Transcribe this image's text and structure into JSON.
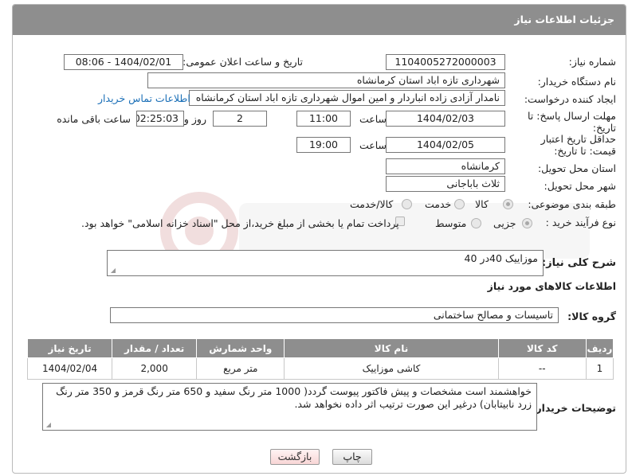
{
  "header": {
    "title": "جزئیات اطلاعات نیاز"
  },
  "need_number": {
    "label": "شماره نیاز:",
    "value": "1104005272000003"
  },
  "announce": {
    "label": "تاریخ و ساعت اعلان عمومی:",
    "value": "1404/02/01 - 08:06"
  },
  "buyer_org": {
    "label": "نام دستگاه خریدار:",
    "value": "شهرداری تازه اباد استان کرمانشاه"
  },
  "creator": {
    "label": "ایجاد کننده درخواست:",
    "value": "نامدار آزادی زاده انباردار و امین اموال شهرداری تازه اباد استان کرمانشاه",
    "contact_link": "اطلاعات تماس خریدار"
  },
  "deadline": {
    "label": "مهلت ارسال پاسخ: تا تاریخ:",
    "date": "1404/02/03",
    "time_label": "ساعت",
    "time": "11:00",
    "days": "2",
    "days_label": "روز و",
    "remaining": "02:25:03",
    "remaining_label": "ساعت باقی مانده"
  },
  "price_validity": {
    "label": "حداقل تاریخ اعتبار قیمت: تا تاریخ:",
    "date": "1404/02/05",
    "time_label": "ساعت",
    "time": "19:00"
  },
  "delivery_province": {
    "label": "استان محل تحویل:",
    "value": "کرمانشاه"
  },
  "delivery_city": {
    "label": "شهر محل تحویل:",
    "value": "ثلاث باباجانی"
  },
  "category": {
    "label": "طبقه بندی موضوعی:",
    "options": [
      "کالا",
      "خدمت",
      "کالا/خدمت"
    ],
    "selected": "کالا"
  },
  "process": {
    "label": "نوع فرآیند خرید :",
    "options": [
      "جزیی",
      "متوسط"
    ],
    "selected": "جزیی",
    "note": "پرداخت تمام یا بخشی از مبلغ خرید،از محل \"اسناد خزانه اسلامی\" خواهد بود."
  },
  "general_desc": {
    "label": "شرح کلی نیاز:",
    "value": "موزاییک 40در 40"
  },
  "goods_info_title": "اطلاعات کالاهای مورد نیاز",
  "goods_group": {
    "label": "گروه کالا:",
    "value": "تاسیسات و مصالح ساختمانی"
  },
  "table": {
    "headers": [
      "ردیف",
      "کد کالا",
      "نام کالا",
      "واحد شمارش",
      "تعداد / مقدار",
      "تاریخ نیاز"
    ],
    "rows": [
      [
        "1",
        "--",
        "کاشی موزاییک",
        "متر مربع",
        "2,000",
        "1404/02/04"
      ]
    ]
  },
  "buyer_notes": {
    "label": "توضیحات خریدار:",
    "value": "خواهشمند است مشخصات و پیش فاکتور پیوست گردد( 1000 متر رنگ سفید و 650 متر رنگ قرمز و 350 متر رنگ زرد نابیتابان) درغیر این صورت ترتیب اثر داده نخواهد شد."
  },
  "buttons": {
    "print": "چاپ",
    "back": "بازگشت"
  },
  "colors": {
    "header_bg": "#8e8e8e",
    "link": "#1a6fb7",
    "back_button": "#f8d6d6"
  }
}
